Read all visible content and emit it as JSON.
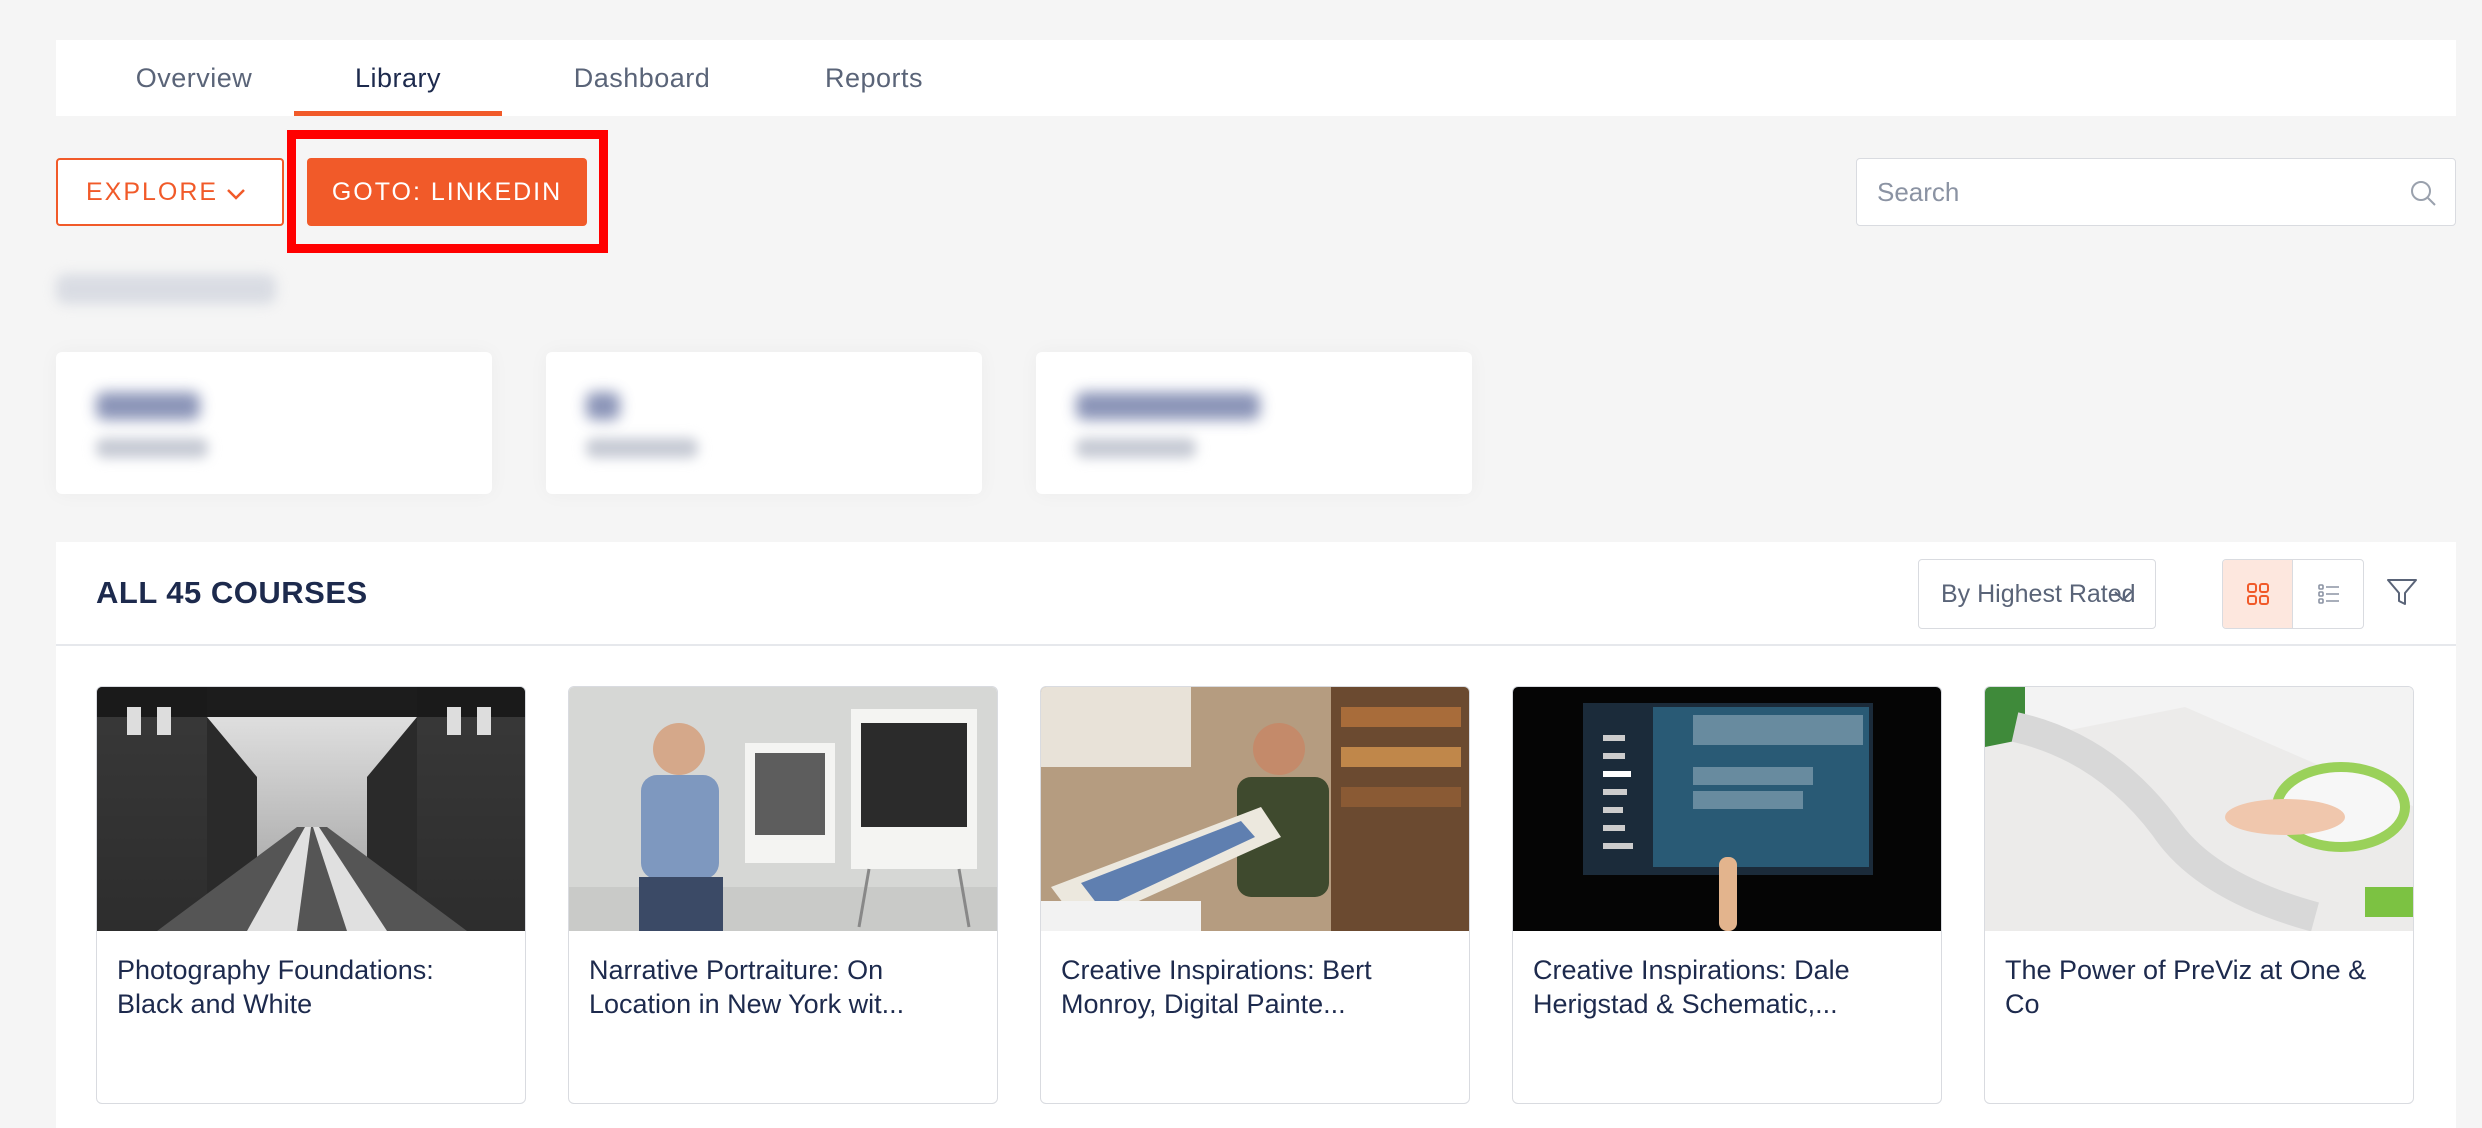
{
  "tabs": [
    {
      "label": "Overview",
      "active": false
    },
    {
      "label": "Library",
      "active": true
    },
    {
      "label": "Dashboard",
      "active": false
    },
    {
      "label": "Reports",
      "active": false
    }
  ],
  "actions": {
    "explore_label": "EXPLORE",
    "goto_label": "GOTO: LINKEDIN"
  },
  "search": {
    "placeholder": "Search"
  },
  "courses_panel": {
    "title": "ALL 45 COURSES",
    "sort_selected": "By Highest Rated",
    "view_mode": "grid",
    "cards": [
      {
        "title": "Photography Foundations: Black and White",
        "thumbnail": "railway-bridge-bw"
      },
      {
        "title": "Narrative Portraiture: On Location in New York wit...",
        "thumbnail": "presenter-with-prints"
      },
      {
        "title": "Creative Inspirations: Bert Monroy, Digital Painte...",
        "thumbnail": "artist-holding-print"
      },
      {
        "title": "Creative Inspirations: Dale Herigstad & Schematic,...",
        "thumbnail": "tv-guide-interface"
      },
      {
        "title": "The Power of PreViz at One & Co",
        "thumbnail": "hand-on-green-mouse"
      }
    ]
  },
  "colors": {
    "accent": "#f15a29",
    "highlight": "#ff0000",
    "navy": "#1d2a4d"
  }
}
